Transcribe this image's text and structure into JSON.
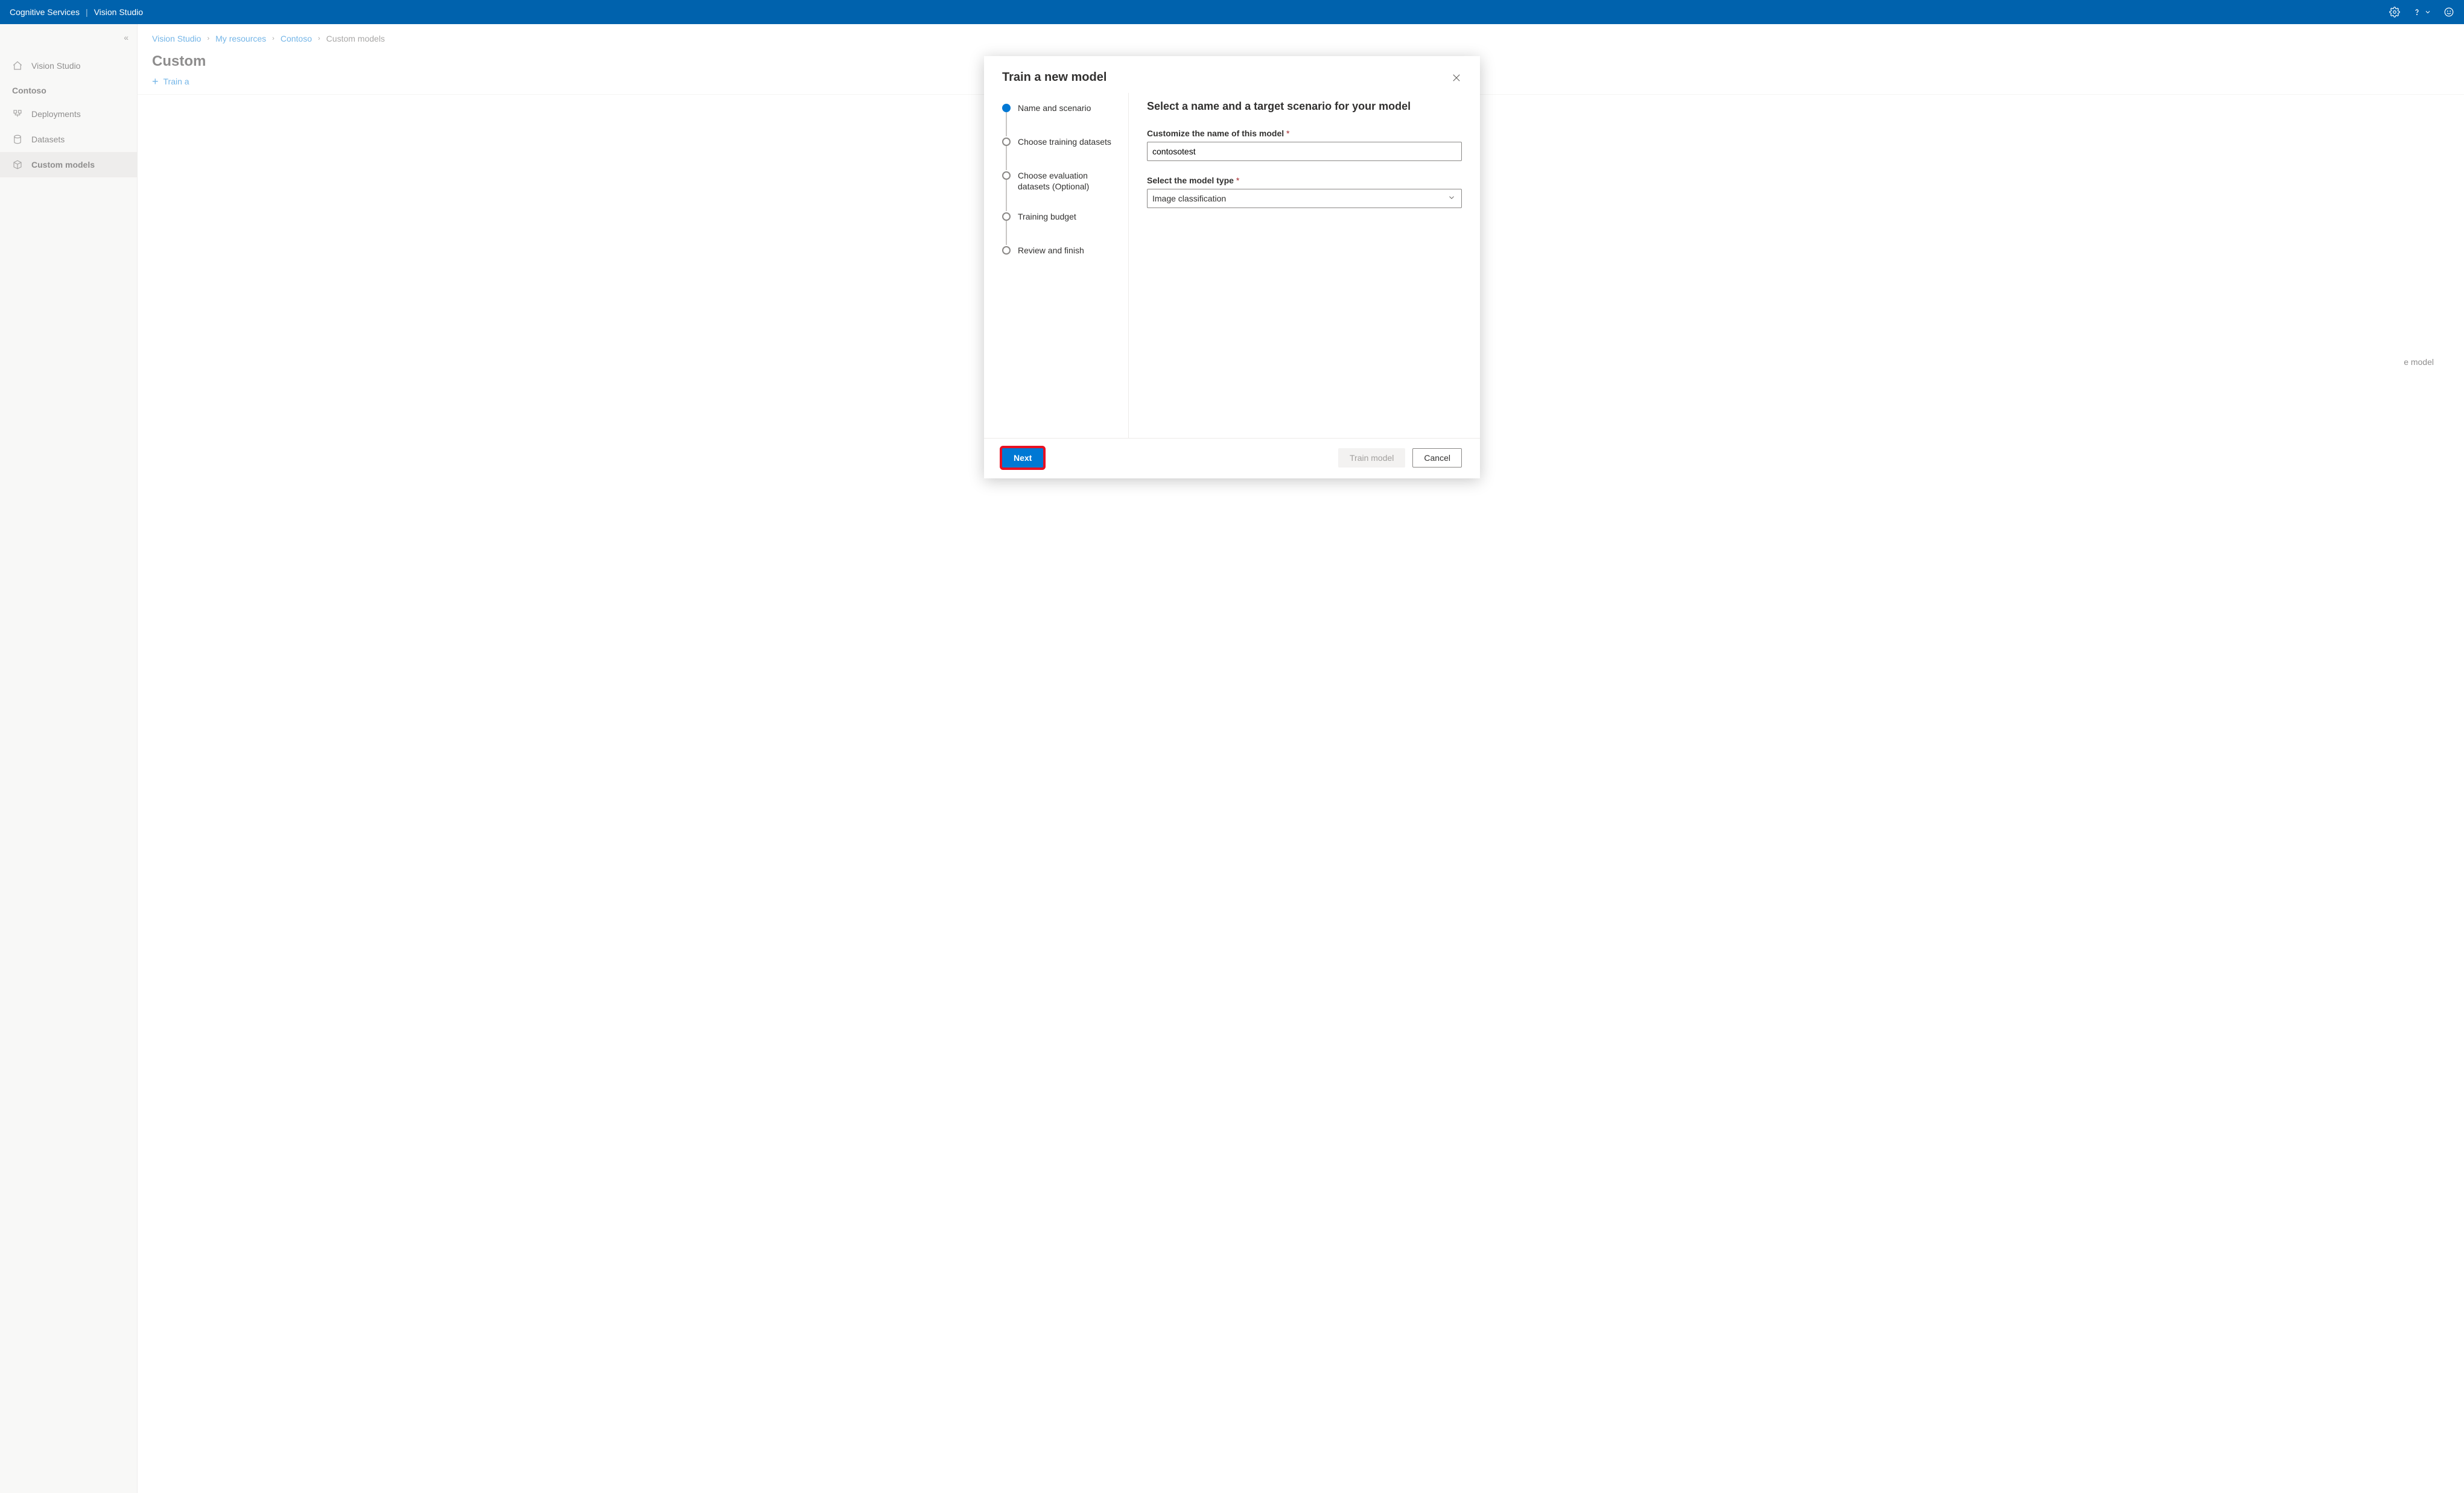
{
  "header": {
    "service": "Cognitive Services",
    "app": "Vision Studio"
  },
  "sidebar": {
    "collapse_glyph": "«",
    "home_label": "Vision Studio",
    "resource_heading": "Contoso",
    "items": [
      {
        "label": "Deployments"
      },
      {
        "label": "Datasets"
      },
      {
        "label": "Custom models"
      }
    ]
  },
  "breadcrumbs": {
    "items": [
      {
        "label": "Vision Studio"
      },
      {
        "label": "My resources"
      },
      {
        "label": "Contoso"
      },
      {
        "label": "Custom models"
      }
    ]
  },
  "page": {
    "title_visible_fragment": "Custom",
    "toolbar_train_fragment": "Train a",
    "peek_text": "e model"
  },
  "modal": {
    "title": "Train a new model",
    "steps": [
      {
        "label": "Name and scenario",
        "active": true
      },
      {
        "label": "Choose training datasets",
        "active": false
      },
      {
        "label": "Choose evaluation datasets (Optional)",
        "active": false
      },
      {
        "label": "Training budget",
        "active": false
      },
      {
        "label": "Review and finish",
        "active": false
      }
    ],
    "form": {
      "heading": "Select a name and a target scenario for your model",
      "name_label": "Customize the name of this model",
      "name_value": "contosotest",
      "type_label": "Select the model type",
      "type_value": "Image classification"
    },
    "footer": {
      "next": "Next",
      "train": "Train model",
      "cancel": "Cancel"
    }
  }
}
